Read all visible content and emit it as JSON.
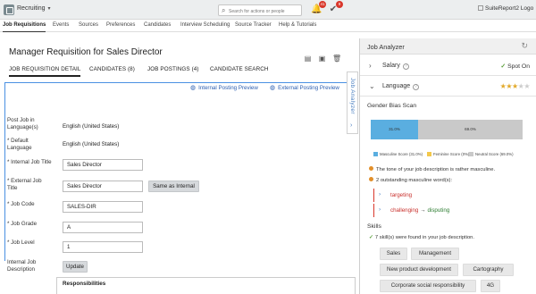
{
  "header": {
    "module": "Recruiting",
    "search_placeholder": "Search for actions or people",
    "notifications_count": "41",
    "approvals_count": "9",
    "company_logo": "SuiteReport2 Logo"
  },
  "nav": {
    "items": [
      "Job Requisitions",
      "Events",
      "Sources",
      "Preferences",
      "Candidates",
      "Interview Scheduling",
      "Source Tracker",
      "Help & Tutorials"
    ]
  },
  "page": {
    "title": "Manager Requisition for Sales Director",
    "tabs": [
      "JOB REQUISITION DETAIL",
      "CANDIDATES (8)",
      "JOB POSTINGS (4)",
      "CANDIDATE SEARCH"
    ],
    "internal_preview": "Internal Posting Preview",
    "external_preview": "External Posting Preview"
  },
  "form": {
    "post_language_label": "Post Job in Language(s)",
    "post_language_value": "English (United States)",
    "default_language_label": "* Default Language",
    "default_language_value": "English (United States)",
    "internal_title_label": "* Internal Job Title",
    "internal_title_value": "Sales Director",
    "external_title_label": "* External Job Title",
    "external_title_value": "Sales Director",
    "same_as_internal": "Same as Internal",
    "job_code_label": "* Job Code",
    "job_code_value": "SALES-DIR",
    "job_grade_label": "* Job Grade",
    "job_grade_value": "A",
    "job_level_label": "* Job Level",
    "job_level_value": "1",
    "internal_desc_label": "Internal Job Description",
    "update_button": "Update",
    "responsibilities": "Responsibilities"
  },
  "analyzer": {
    "collapse_label": "Job Analyzer",
    "title": "Job Analyzer",
    "salary_label": "Salary",
    "salary_status": "Spot On",
    "language_label": "Language",
    "language_rating": 3,
    "language_max": 5,
    "gender_bias_title": "Gender Bias Scan",
    "bias": {
      "masculine_pct": 31.0,
      "masculine_label": "31.0%",
      "neutral_pct": 69.0,
      "neutral_label": "69.0%"
    },
    "legend": [
      "Masculine Score (31.0%)",
      "Feminine Score (0%)",
      "Neutral Score (69.0%)"
    ],
    "colors": {
      "masculine": "#5aaee0",
      "feminine": "#f3c84b",
      "neutral": "#c9c9c9"
    },
    "tone_note": "The tone of your job description is rather masculine.",
    "words_note": "2 outstanding masculine word(s):",
    "words": [
      {
        "word": "targeting",
        "alternative": ""
      },
      {
        "word": "challenging",
        "alternative": "disputing"
      }
    ],
    "skills_title": "Skills",
    "skills_note": "7 skill(s) were found in your job description.",
    "skills": [
      "Sales",
      "Management",
      "New product development",
      "Cartography",
      "Corporate social responsibility",
      "4G"
    ]
  }
}
